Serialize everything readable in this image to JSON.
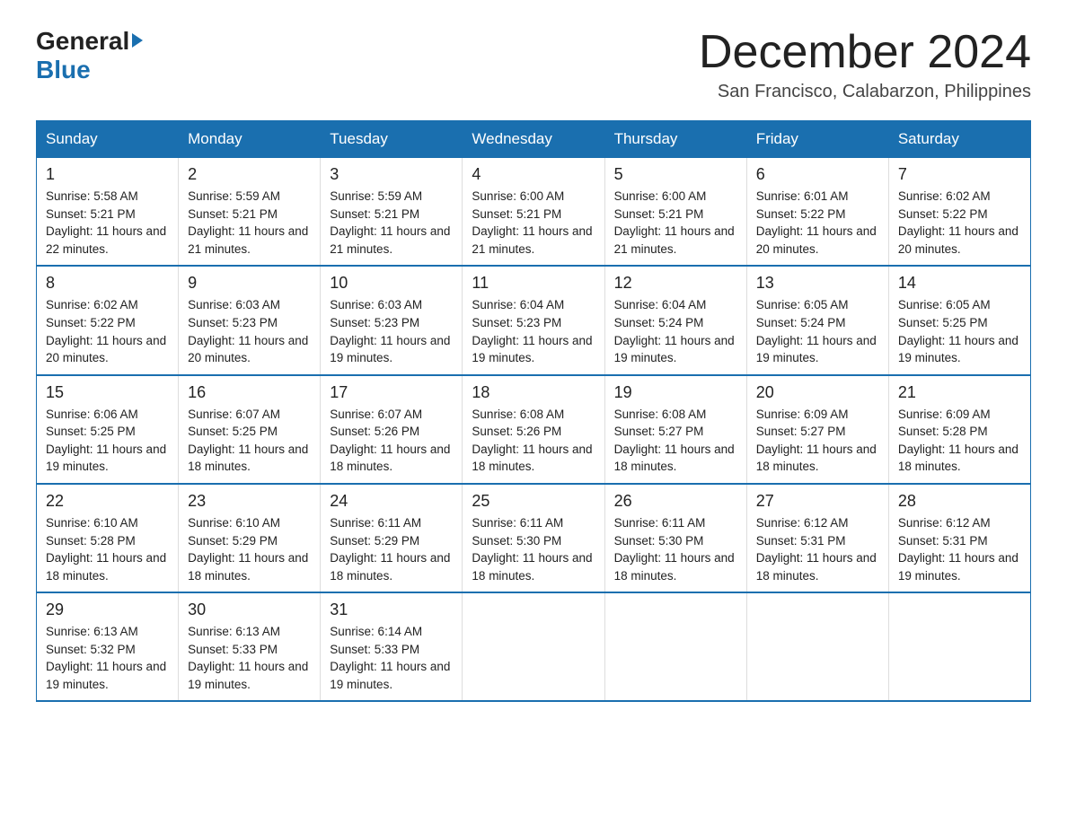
{
  "logo": {
    "text_general": "General",
    "arrow": "▶",
    "text_blue": "Blue"
  },
  "header": {
    "month_title": "December 2024",
    "location": "San Francisco, Calabarzon, Philippines"
  },
  "days_of_week": [
    "Sunday",
    "Monday",
    "Tuesday",
    "Wednesday",
    "Thursday",
    "Friday",
    "Saturday"
  ],
  "weeks": [
    [
      {
        "day": "1",
        "sunrise": "5:58 AM",
        "sunset": "5:21 PM",
        "daylight": "11 hours and 22 minutes."
      },
      {
        "day": "2",
        "sunrise": "5:59 AM",
        "sunset": "5:21 PM",
        "daylight": "11 hours and 21 minutes."
      },
      {
        "day": "3",
        "sunrise": "5:59 AM",
        "sunset": "5:21 PM",
        "daylight": "11 hours and 21 minutes."
      },
      {
        "day": "4",
        "sunrise": "6:00 AM",
        "sunset": "5:21 PM",
        "daylight": "11 hours and 21 minutes."
      },
      {
        "day": "5",
        "sunrise": "6:00 AM",
        "sunset": "5:21 PM",
        "daylight": "11 hours and 21 minutes."
      },
      {
        "day": "6",
        "sunrise": "6:01 AM",
        "sunset": "5:22 PM",
        "daylight": "11 hours and 20 minutes."
      },
      {
        "day": "7",
        "sunrise": "6:02 AM",
        "sunset": "5:22 PM",
        "daylight": "11 hours and 20 minutes."
      }
    ],
    [
      {
        "day": "8",
        "sunrise": "6:02 AM",
        "sunset": "5:22 PM",
        "daylight": "11 hours and 20 minutes."
      },
      {
        "day": "9",
        "sunrise": "6:03 AM",
        "sunset": "5:23 PM",
        "daylight": "11 hours and 20 minutes."
      },
      {
        "day": "10",
        "sunrise": "6:03 AM",
        "sunset": "5:23 PM",
        "daylight": "11 hours and 19 minutes."
      },
      {
        "day": "11",
        "sunrise": "6:04 AM",
        "sunset": "5:23 PM",
        "daylight": "11 hours and 19 minutes."
      },
      {
        "day": "12",
        "sunrise": "6:04 AM",
        "sunset": "5:24 PM",
        "daylight": "11 hours and 19 minutes."
      },
      {
        "day": "13",
        "sunrise": "6:05 AM",
        "sunset": "5:24 PM",
        "daylight": "11 hours and 19 minutes."
      },
      {
        "day": "14",
        "sunrise": "6:05 AM",
        "sunset": "5:25 PM",
        "daylight": "11 hours and 19 minutes."
      }
    ],
    [
      {
        "day": "15",
        "sunrise": "6:06 AM",
        "sunset": "5:25 PM",
        "daylight": "11 hours and 19 minutes."
      },
      {
        "day": "16",
        "sunrise": "6:07 AM",
        "sunset": "5:25 PM",
        "daylight": "11 hours and 18 minutes."
      },
      {
        "day": "17",
        "sunrise": "6:07 AM",
        "sunset": "5:26 PM",
        "daylight": "11 hours and 18 minutes."
      },
      {
        "day": "18",
        "sunrise": "6:08 AM",
        "sunset": "5:26 PM",
        "daylight": "11 hours and 18 minutes."
      },
      {
        "day": "19",
        "sunrise": "6:08 AM",
        "sunset": "5:27 PM",
        "daylight": "11 hours and 18 minutes."
      },
      {
        "day": "20",
        "sunrise": "6:09 AM",
        "sunset": "5:27 PM",
        "daylight": "11 hours and 18 minutes."
      },
      {
        "day": "21",
        "sunrise": "6:09 AM",
        "sunset": "5:28 PM",
        "daylight": "11 hours and 18 minutes."
      }
    ],
    [
      {
        "day": "22",
        "sunrise": "6:10 AM",
        "sunset": "5:28 PM",
        "daylight": "11 hours and 18 minutes."
      },
      {
        "day": "23",
        "sunrise": "6:10 AM",
        "sunset": "5:29 PM",
        "daylight": "11 hours and 18 minutes."
      },
      {
        "day": "24",
        "sunrise": "6:11 AM",
        "sunset": "5:29 PM",
        "daylight": "11 hours and 18 minutes."
      },
      {
        "day": "25",
        "sunrise": "6:11 AM",
        "sunset": "5:30 PM",
        "daylight": "11 hours and 18 minutes."
      },
      {
        "day": "26",
        "sunrise": "6:11 AM",
        "sunset": "5:30 PM",
        "daylight": "11 hours and 18 minutes."
      },
      {
        "day": "27",
        "sunrise": "6:12 AM",
        "sunset": "5:31 PM",
        "daylight": "11 hours and 18 minutes."
      },
      {
        "day": "28",
        "sunrise": "6:12 AM",
        "sunset": "5:31 PM",
        "daylight": "11 hours and 19 minutes."
      }
    ],
    [
      {
        "day": "29",
        "sunrise": "6:13 AM",
        "sunset": "5:32 PM",
        "daylight": "11 hours and 19 minutes."
      },
      {
        "day": "30",
        "sunrise": "6:13 AM",
        "sunset": "5:33 PM",
        "daylight": "11 hours and 19 minutes."
      },
      {
        "day": "31",
        "sunrise": "6:14 AM",
        "sunset": "5:33 PM",
        "daylight": "11 hours and 19 minutes."
      },
      null,
      null,
      null,
      null
    ]
  ]
}
